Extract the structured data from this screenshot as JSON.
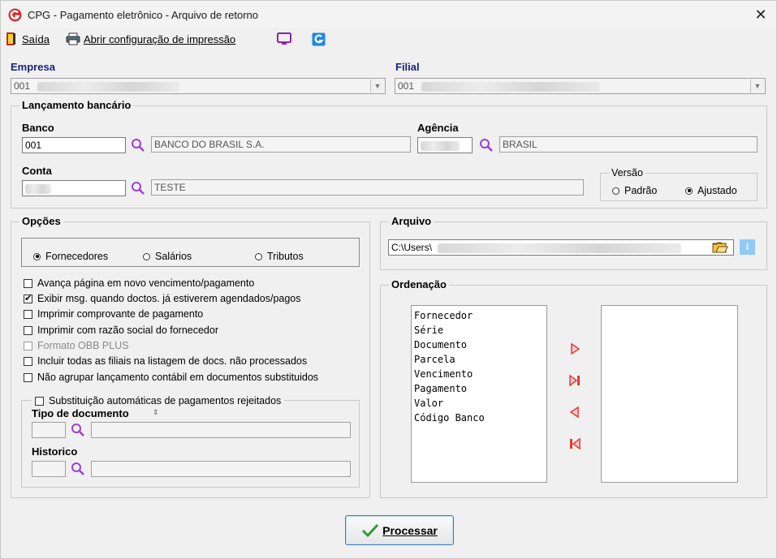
{
  "window": {
    "title": "CPG - Pagamento eletrônico - Arquivo de retorno",
    "close_glyph": "✕"
  },
  "toolbar": {
    "exit": {
      "label": "Saída",
      "icon": "exit-door-icon"
    },
    "print": {
      "label": "Abrir configuração de impressão",
      "icon": "printer-icon"
    },
    "extra_icons": [
      "monitor-icon",
      "brand-g-icon"
    ]
  },
  "empresa": {
    "label": "Empresa",
    "value": "001"
  },
  "filial": {
    "label": "Filial",
    "value": "001"
  },
  "lancamento": {
    "group_label": "Lançamento bancário",
    "banco_label": "Banco",
    "banco_code": "001",
    "banco_name": "BANCO DO BRASIL S.A.",
    "agencia_label": "Agência",
    "agencia_name": "BRASIL",
    "conta_label": "Conta",
    "conta_desc": "TESTE",
    "versao": {
      "label": "Versão",
      "options": [
        "Padrão",
        "Ajustado"
      ],
      "selected": "Ajustado"
    }
  },
  "opcoes": {
    "group_label": "Opções",
    "radios": [
      "Fornecedores",
      "Salários",
      "Tributos"
    ],
    "selected": "Fornecedores",
    "checkboxes": [
      {
        "label": "Avança página em novo vencimento/pagamento",
        "checked": false,
        "enabled": true
      },
      {
        "label": "Exibir msg. quando doctos. já estiverem agendados/pagos",
        "checked": true,
        "enabled": true
      },
      {
        "label": "Imprimir comprovante de pagamento",
        "checked": false,
        "enabled": true
      },
      {
        "label": "Imprimir com razão social do fornecedor",
        "checked": false,
        "enabled": true
      },
      {
        "label": "Formato OBB PLUS",
        "checked": false,
        "enabled": false
      },
      {
        "label": "Incluir todas as filiais na listagem de docs. não processados",
        "checked": false,
        "enabled": true
      },
      {
        "label": "Não agrupar lançamento contábil em documentos substituidos",
        "checked": false,
        "enabled": true
      }
    ],
    "substituicao": {
      "label": "Substituição automáticas de pagamentos rejeitados",
      "checked": false,
      "tipo_label": "Tipo de documento",
      "historico_label": "Historico"
    }
  },
  "arquivo": {
    "group_label": "Arquivo",
    "path": "C:\\Users\\",
    "info_glyph": "i"
  },
  "ordenacao": {
    "group_label": "Ordenação",
    "available": [
      "Fornecedor",
      "Série",
      "Documento",
      "Parcela",
      "Vencimento",
      "Pagamento",
      "Valor",
      "Código Banco"
    ],
    "selected": []
  },
  "actions": {
    "process_label": "Processar"
  },
  "colors": {
    "accent": "#1a237e",
    "icon_purple": "#9c3fd6",
    "arrow_red": "#e53935",
    "check_green": "#2e9b3a"
  }
}
